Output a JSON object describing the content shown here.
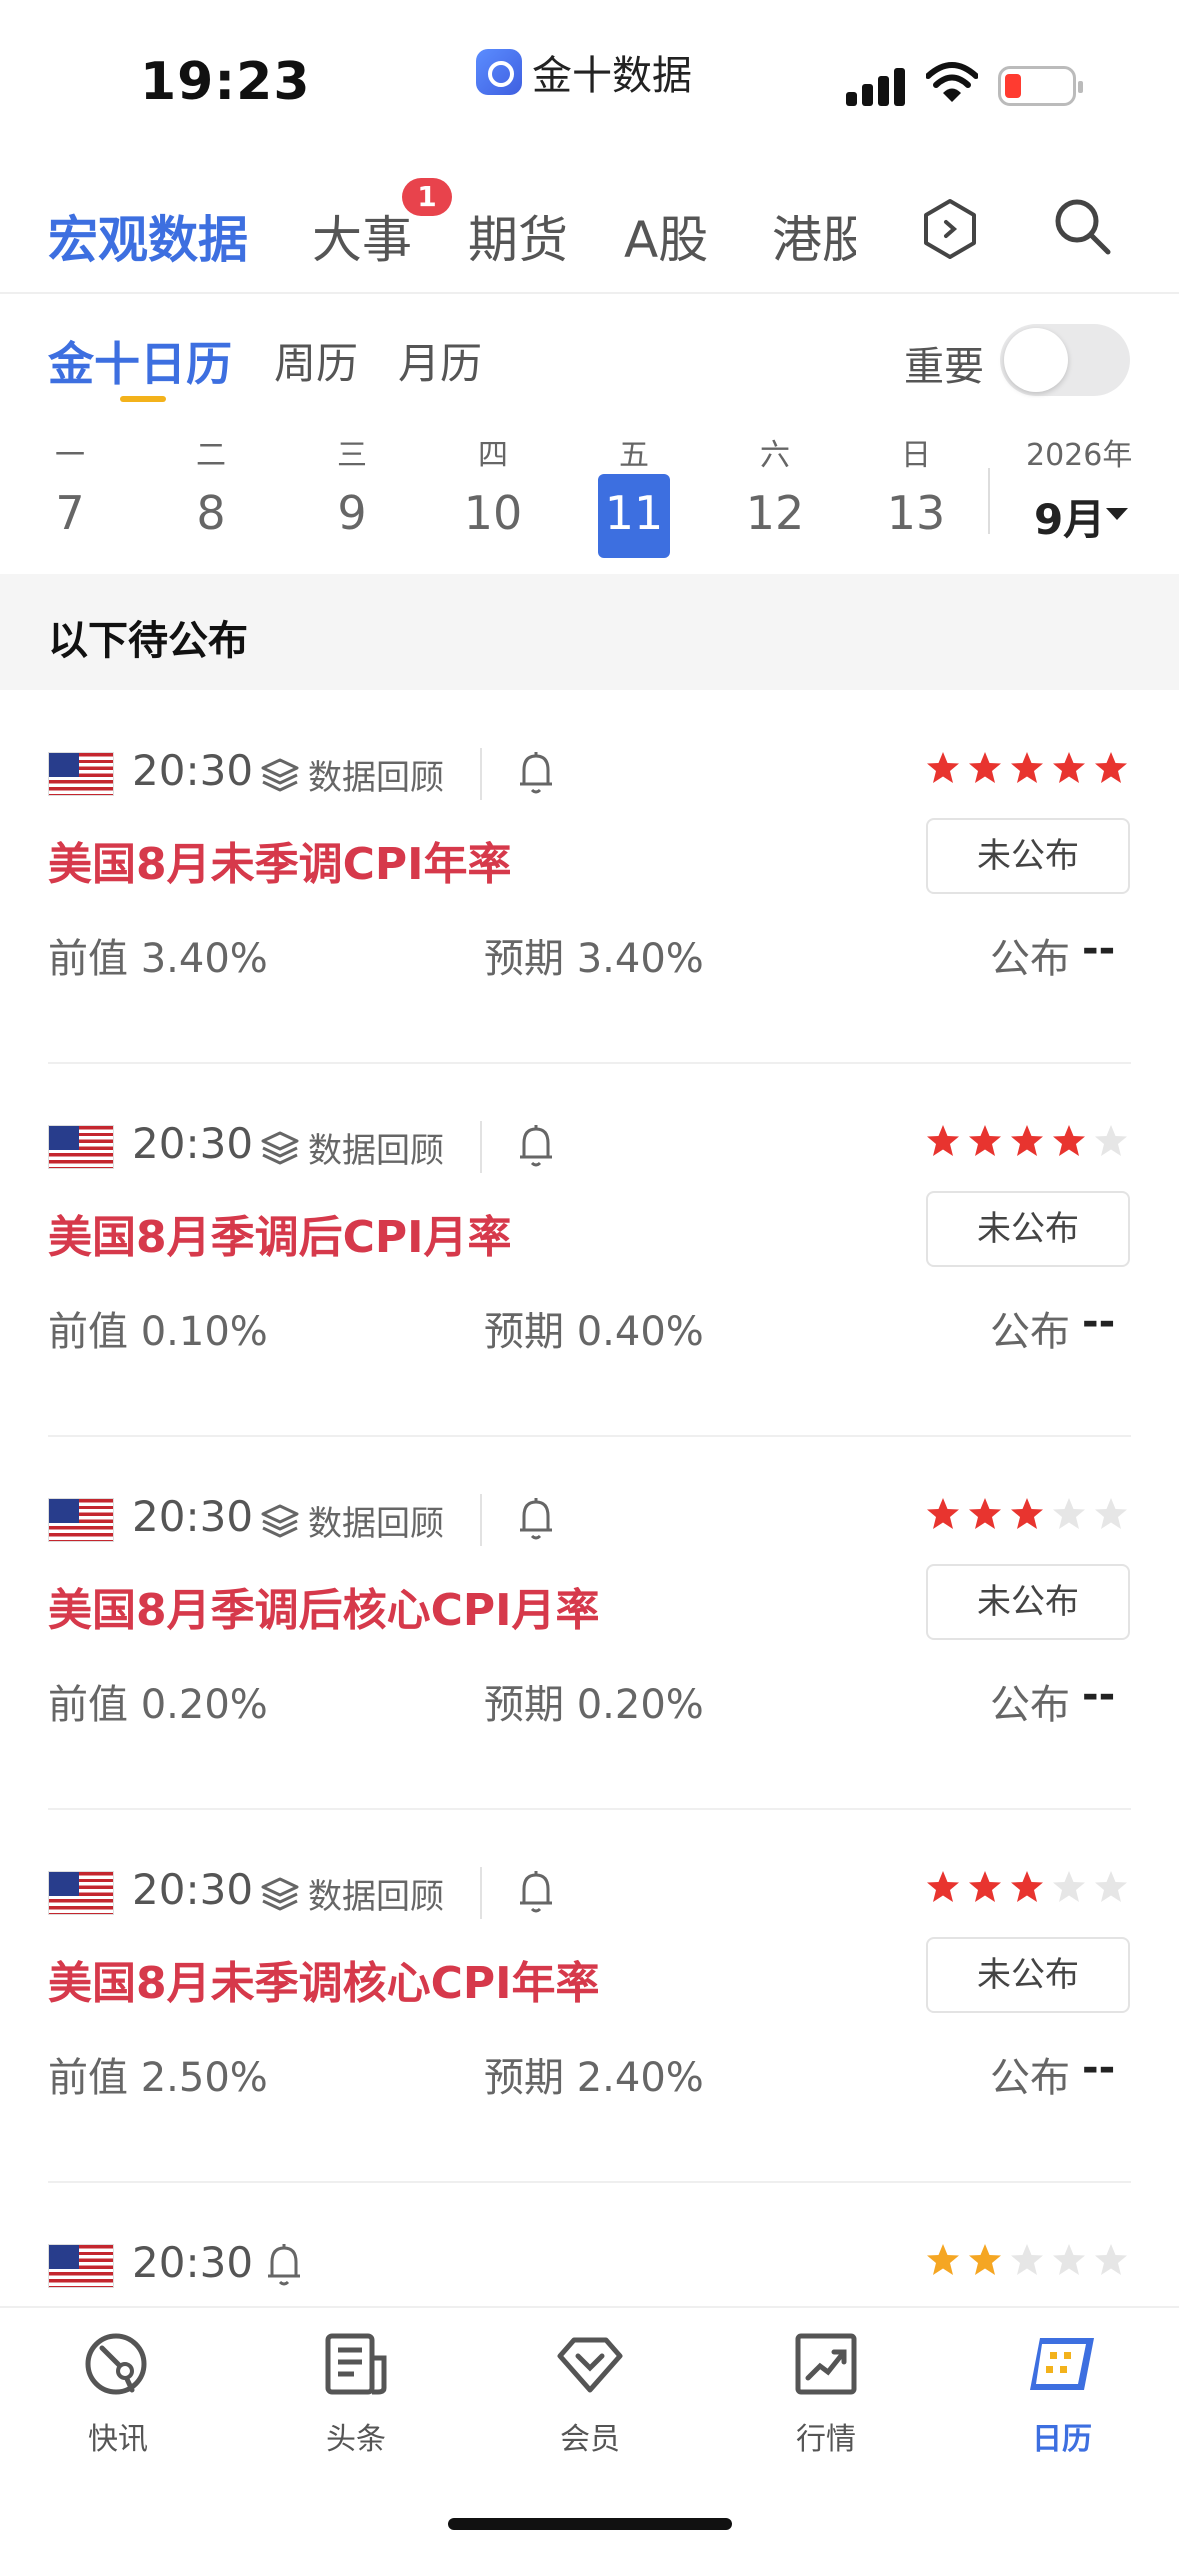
{
  "status_bar": {
    "time": "19:23",
    "app_name": "金十数据",
    "battery_color": "#ff3b30"
  },
  "top_tabs": [
    {
      "label": "宏观数据",
      "active": true
    },
    {
      "label": "大事",
      "active": false,
      "badge": "1"
    },
    {
      "label": "期货",
      "active": false
    },
    {
      "label": "A股",
      "active": false
    },
    {
      "label": "港股",
      "active": false
    }
  ],
  "top_icons": [
    "hexagon-icon",
    "search-icon"
  ],
  "sub_tabs": [
    {
      "label": "金十日历",
      "active": true
    },
    {
      "label": "周历",
      "active": false
    },
    {
      "label": "月历",
      "active": false
    }
  ],
  "important_toggle": {
    "label": "重要",
    "on": false
  },
  "week": {
    "days": [
      {
        "weekday": "一",
        "date": "7"
      },
      {
        "weekday": "二",
        "date": "8"
      },
      {
        "weekday": "三",
        "date": "9"
      },
      {
        "weekday": "四",
        "date": "10"
      },
      {
        "weekday": "五",
        "date": "11",
        "selected": true
      },
      {
        "weekday": "六",
        "date": "12"
      },
      {
        "weekday": "日",
        "date": "13"
      }
    ],
    "year": "2026年",
    "month": "9月"
  },
  "section_title": "以下待公布",
  "review_label": "数据回顾",
  "events": [
    {
      "flag": "us-flag-icon",
      "time": "20:30",
      "has_review": true,
      "stars": 5,
      "title": "美国8月未季调CPI年率",
      "status": "未公布",
      "previous": "前值 3.40%",
      "forecast": "预期 3.40%",
      "actual_label": "公布",
      "actual_value": "--"
    },
    {
      "flag": "us-flag-icon",
      "time": "20:30",
      "has_review": true,
      "stars": 4,
      "title": "美国8月季调后CPI月率",
      "status": "未公布",
      "previous": "前值 0.10%",
      "forecast": "预期 0.40%",
      "actual_label": "公布",
      "actual_value": "--"
    },
    {
      "flag": "us-flag-icon",
      "time": "20:30",
      "has_review": true,
      "stars": 3,
      "title": "美国8月季调后核心CPI月率",
      "status": "未公布",
      "previous": "前值 0.20%",
      "forecast": "预期 0.20%",
      "actual_label": "公布",
      "actual_value": "--"
    },
    {
      "flag": "us-flag-icon",
      "time": "20:30",
      "has_review": true,
      "stars": 3,
      "title": "美国8月未季调核心CPI年率",
      "status": "未公布",
      "previous": "前值 2.50%",
      "forecast": "预期 2.40%",
      "actual_label": "公布",
      "actual_value": "--"
    },
    {
      "flag": "us-flag-icon",
      "time": "20:30",
      "has_review": false,
      "stars": 2,
      "star_color": "#f5a623"
    }
  ],
  "colors": {
    "accent": "#3d6fe0",
    "title_red": "#d6394b",
    "star_red": "#e8342f",
    "star_orange": "#f5a623",
    "star_empty": "#e6e6e6"
  },
  "bottom_nav": [
    {
      "label": "快讯",
      "icon": "flash-news-icon",
      "active": false
    },
    {
      "label": "头条",
      "icon": "headline-icon",
      "active": false
    },
    {
      "label": "会员",
      "icon": "member-diamond-icon",
      "active": false
    },
    {
      "label": "行情",
      "icon": "market-chart-icon",
      "active": false
    },
    {
      "label": "日历",
      "icon": "calendar-icon",
      "active": true
    }
  ]
}
